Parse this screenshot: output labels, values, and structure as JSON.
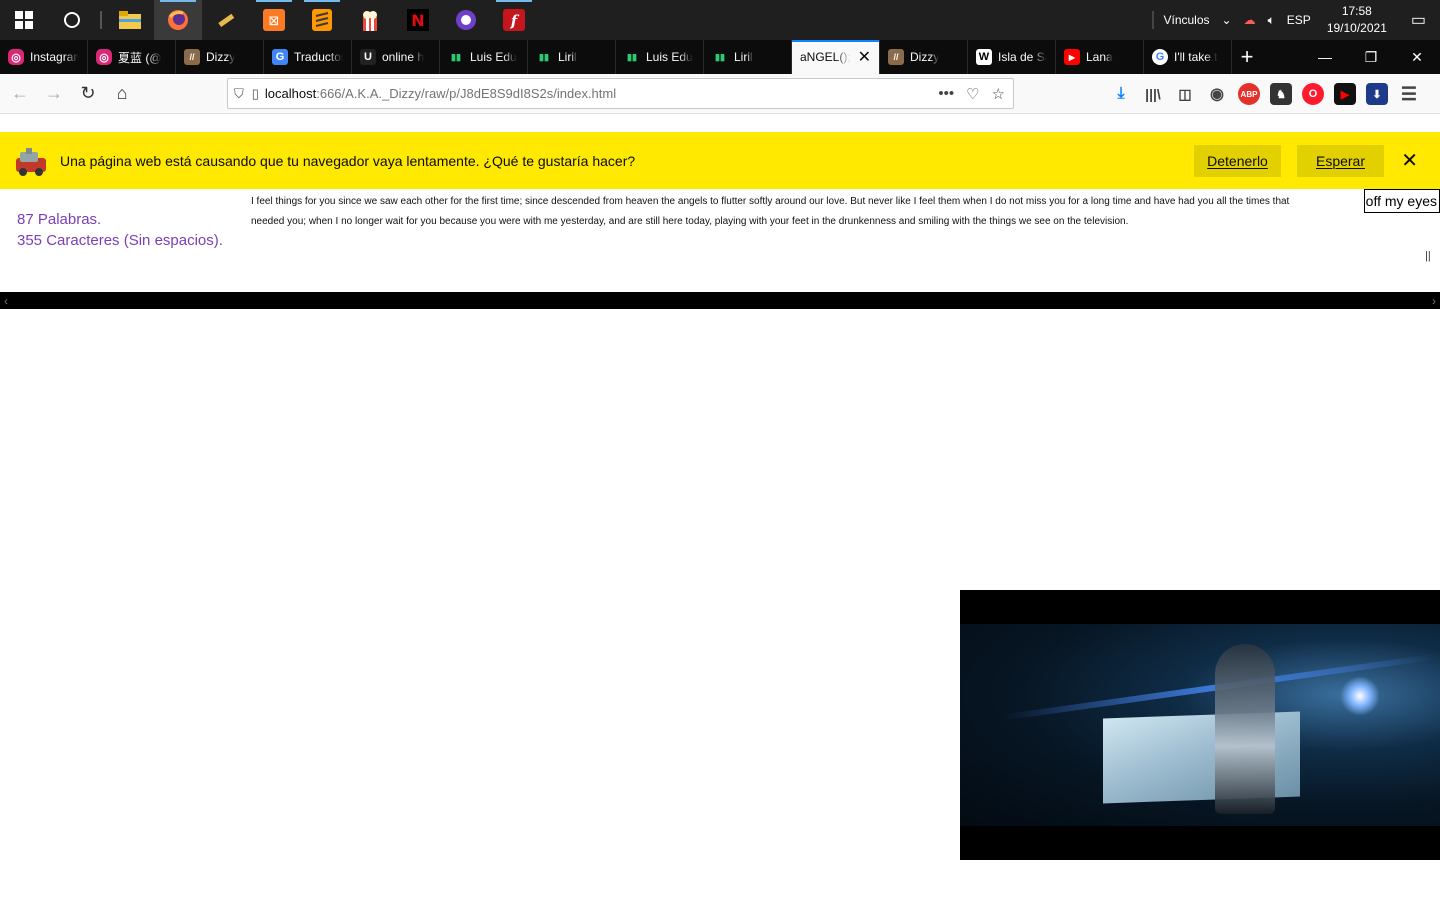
{
  "taskbar": {
    "apps": [
      {
        "name": "start-icon"
      },
      {
        "name": "cortana-icon"
      },
      {
        "name": "file-explorer-icon"
      },
      {
        "name": "firefox-icon"
      },
      {
        "name": "app-hammer-icon"
      },
      {
        "name": "xampp-icon"
      },
      {
        "name": "sublime-text-icon"
      },
      {
        "name": "popcorn-time-icon"
      },
      {
        "name": "netflix-icon"
      },
      {
        "name": "github-desktop-icon"
      },
      {
        "name": "flash-icon"
      }
    ],
    "links_label": "Vínculos",
    "language": "ESP",
    "time": "17:58",
    "date": "19/10/2021"
  },
  "tabs": [
    {
      "title": "Instagram",
      "icon": "instagram-icon",
      "color": "#d62976"
    },
    {
      "title": "夏蓝 (@",
      "icon": "instagram-icon",
      "color": "#d62976"
    },
    {
      "title": "Dizzy",
      "icon": "dizzy-icon",
      "color": "#8b6b4a"
    },
    {
      "title": "Traductor",
      "icon": "google-translate-icon",
      "color": "#4285f4"
    },
    {
      "title": "online h",
      "icon": "ui-icon",
      "color": "#222222"
    },
    {
      "title": "Luis Edu",
      "icon": "chart-icon",
      "color": "#2ecc71"
    },
    {
      "title": "Liril",
      "icon": "chart-icon",
      "color": "#2ecc71"
    },
    {
      "title": "Luis Edu",
      "icon": "chart-icon",
      "color": "#2ecc71"
    },
    {
      "title": "Liril",
      "icon": "chart-icon",
      "color": "#2ecc71"
    },
    {
      "title": "aNGEL();",
      "icon": "",
      "color": "",
      "selected": true
    },
    {
      "title": "Dizzy",
      "icon": "dizzy-icon",
      "color": "#8b6b4a"
    },
    {
      "title": "Isla de Sa",
      "icon": "wikipedia-icon",
      "color": "#ffffff"
    },
    {
      "title": "Lana",
      "icon": "youtube-icon",
      "color": "#ff0000"
    },
    {
      "title": "I'll take t",
      "icon": "google-icon",
      "color": "#4285f4"
    }
  ],
  "address": {
    "host": "localhost",
    "path": ":666/A.K.A._Dizzy/raw/p/J8dE8S9dI8S2s/index.html"
  },
  "notification": {
    "message": "Una página web está causando que tu navegador vaya lentamente. ¿Qué te gustaría hacer?",
    "stop_label": "Detenerlo",
    "wait_label": "Esperar"
  },
  "page": {
    "word_count": "87 Palabras.",
    "char_count": "355 Caracteres (Sin espacios).",
    "poem_line1": "I feel things for you since we saw each other for the first time; since descended from heaven the angels to flutter softly around our love. But never like I feel them when I do not miss you for a long time and have had you all the times that",
    "poem_line2": "needed you; when I no longer wait for you because you were with me yesterday, and are still here today, playing with your feet in the drunkenness and smiling with the things we see on the television.",
    "lyric_box": "off my eyes.",
    "handle": "||"
  },
  "colors": {
    "notification_bg": "#ffe900",
    "stats_text": "#7a3fb8",
    "tab_accent": "#0a84ff"
  }
}
